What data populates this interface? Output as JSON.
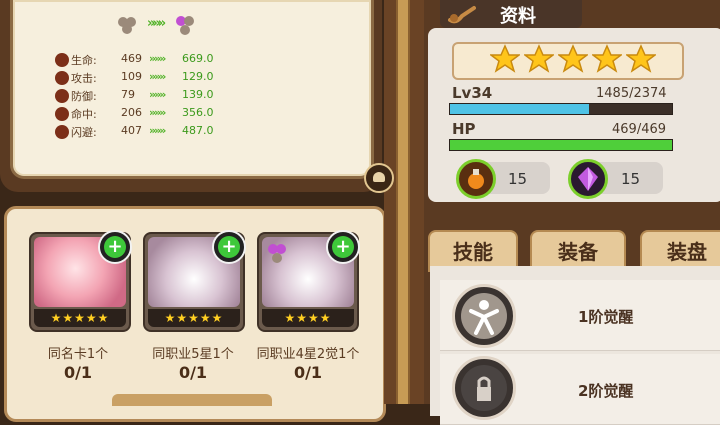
{
  "stats": {
    "rows": [
      {
        "name": "生命:",
        "before": "469",
        "after": "669.0"
      },
      {
        "name": "攻击:",
        "before": "109",
        "after": "129.0"
      },
      {
        "name": "防御:",
        "before": "79",
        "after": "139.0"
      },
      {
        "name": "命中:",
        "before": "206",
        "after": "356.0"
      },
      {
        "name": "闪避:",
        "before": "407",
        "after": "487.0"
      }
    ],
    "arrow": "»»»"
  },
  "requirements": [
    {
      "label": "同名卡1个",
      "count": "0/1",
      "stars": "★★★★★"
    },
    {
      "label": "同职业5星1个",
      "count": "0/1",
      "stars": "★★★★★"
    },
    {
      "label": "同职业4星2觉1个",
      "count": "0/1",
      "stars": "★★★★"
    }
  ],
  "info": {
    "title": "资料",
    "stars": 5,
    "level_label": "Lv34",
    "exp_text": "1485/2374",
    "exp_fraction": 0.626,
    "hp_label": "HP",
    "hp_text": "469/469",
    "hp_fraction": 1.0,
    "potion_count": "15",
    "crystal_count": "15"
  },
  "tabs": [
    "技能",
    "装备",
    "装盘"
  ],
  "skills": [
    {
      "name": "1阶觉醒"
    },
    {
      "name": "2阶觉醒"
    }
  ],
  "colors": {
    "exp_bar": "#4fc3e6",
    "hp_bar": "#4fcf3a",
    "star": "#ffc51a",
    "plus_green": "#3ec83a"
  }
}
